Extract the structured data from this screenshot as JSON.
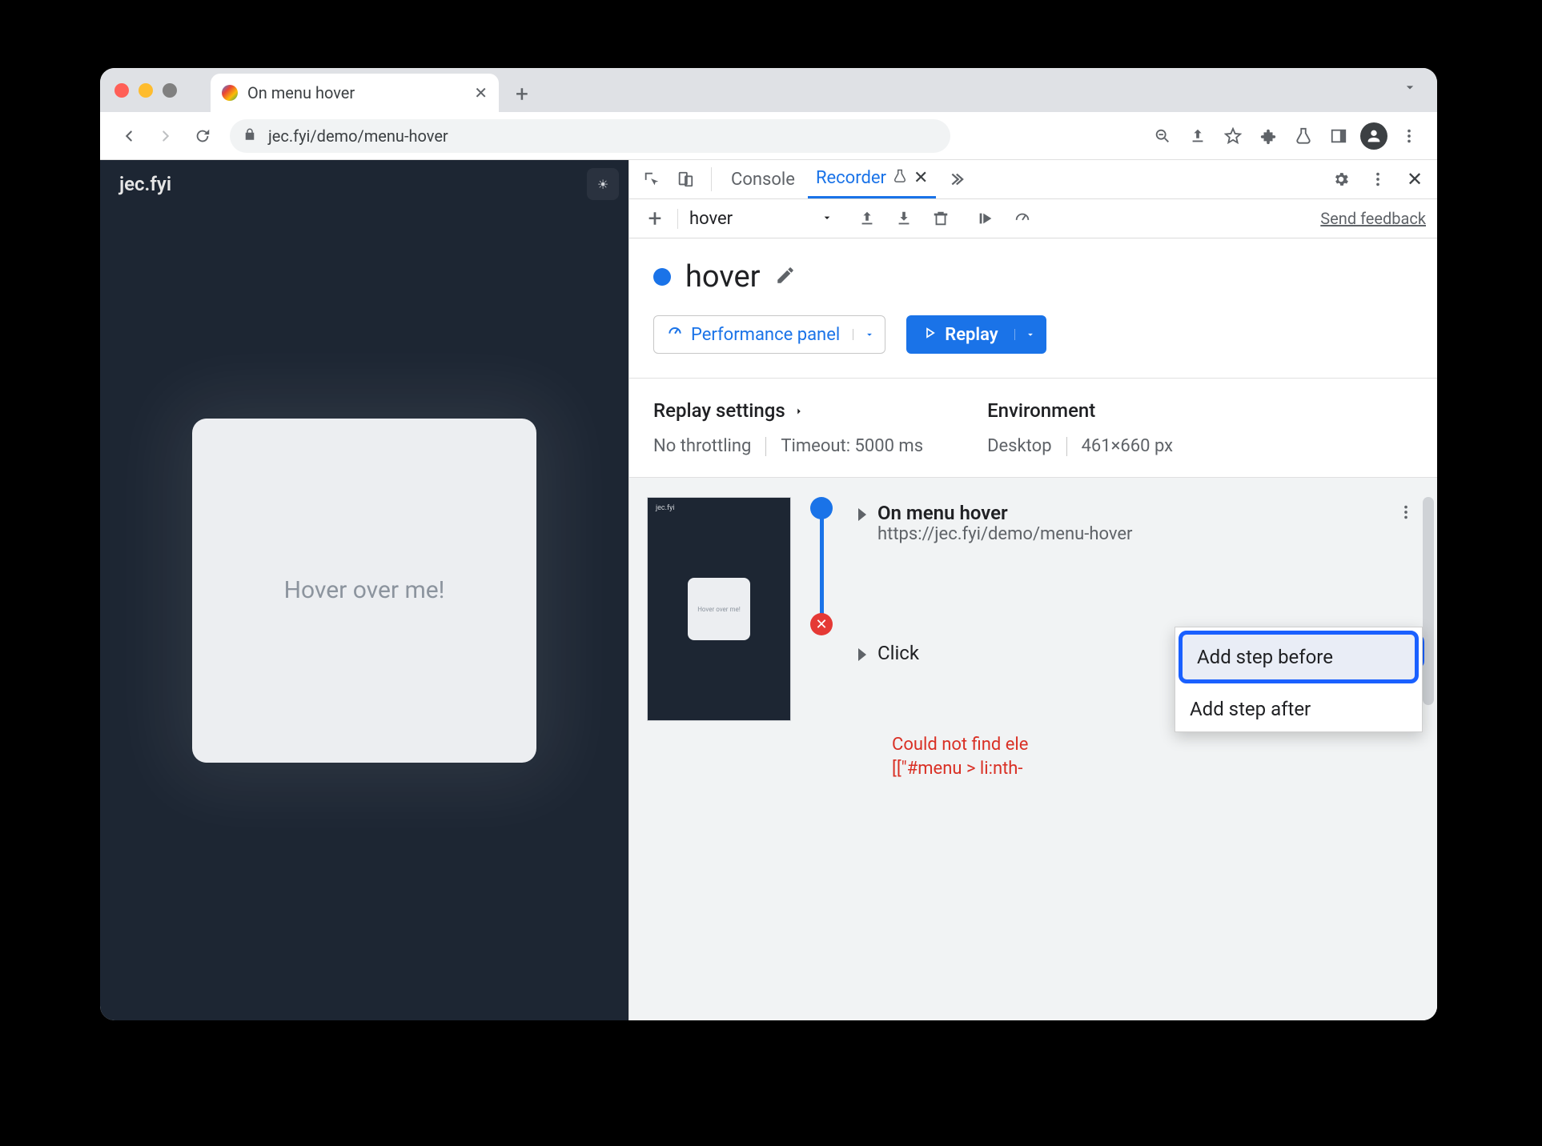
{
  "tab": {
    "title": "On menu hover"
  },
  "addr": {
    "url": "jec.fyi/demo/menu-hover"
  },
  "demo": {
    "siteTitle": "jec.fyi",
    "card": "Hover over me!"
  },
  "devtools": {
    "tabs": {
      "console": "Console",
      "recorder": "Recorder"
    },
    "recbar": {
      "recordingName": "hover",
      "feedback": "Send feedback"
    },
    "title": "hover",
    "perfBtn": "Performance panel",
    "replayBtn": "Replay",
    "settings": {
      "replayHeading": "Replay settings",
      "throttling": "No throttling",
      "timeout": "Timeout: 5000 ms",
      "envHeading": "Environment",
      "device": "Desktop",
      "dims": "461×660 px"
    },
    "steps": {
      "s1title": "On menu hover",
      "s1url": "https://jec.fyi/demo/menu-hover",
      "s2title": "Click",
      "errorL1": "Could not find ele",
      "errorL2": "[[\"#menu > li:nth-"
    },
    "menu": {
      "addBefore": "Add step before",
      "addAfter": "Add step after"
    }
  }
}
